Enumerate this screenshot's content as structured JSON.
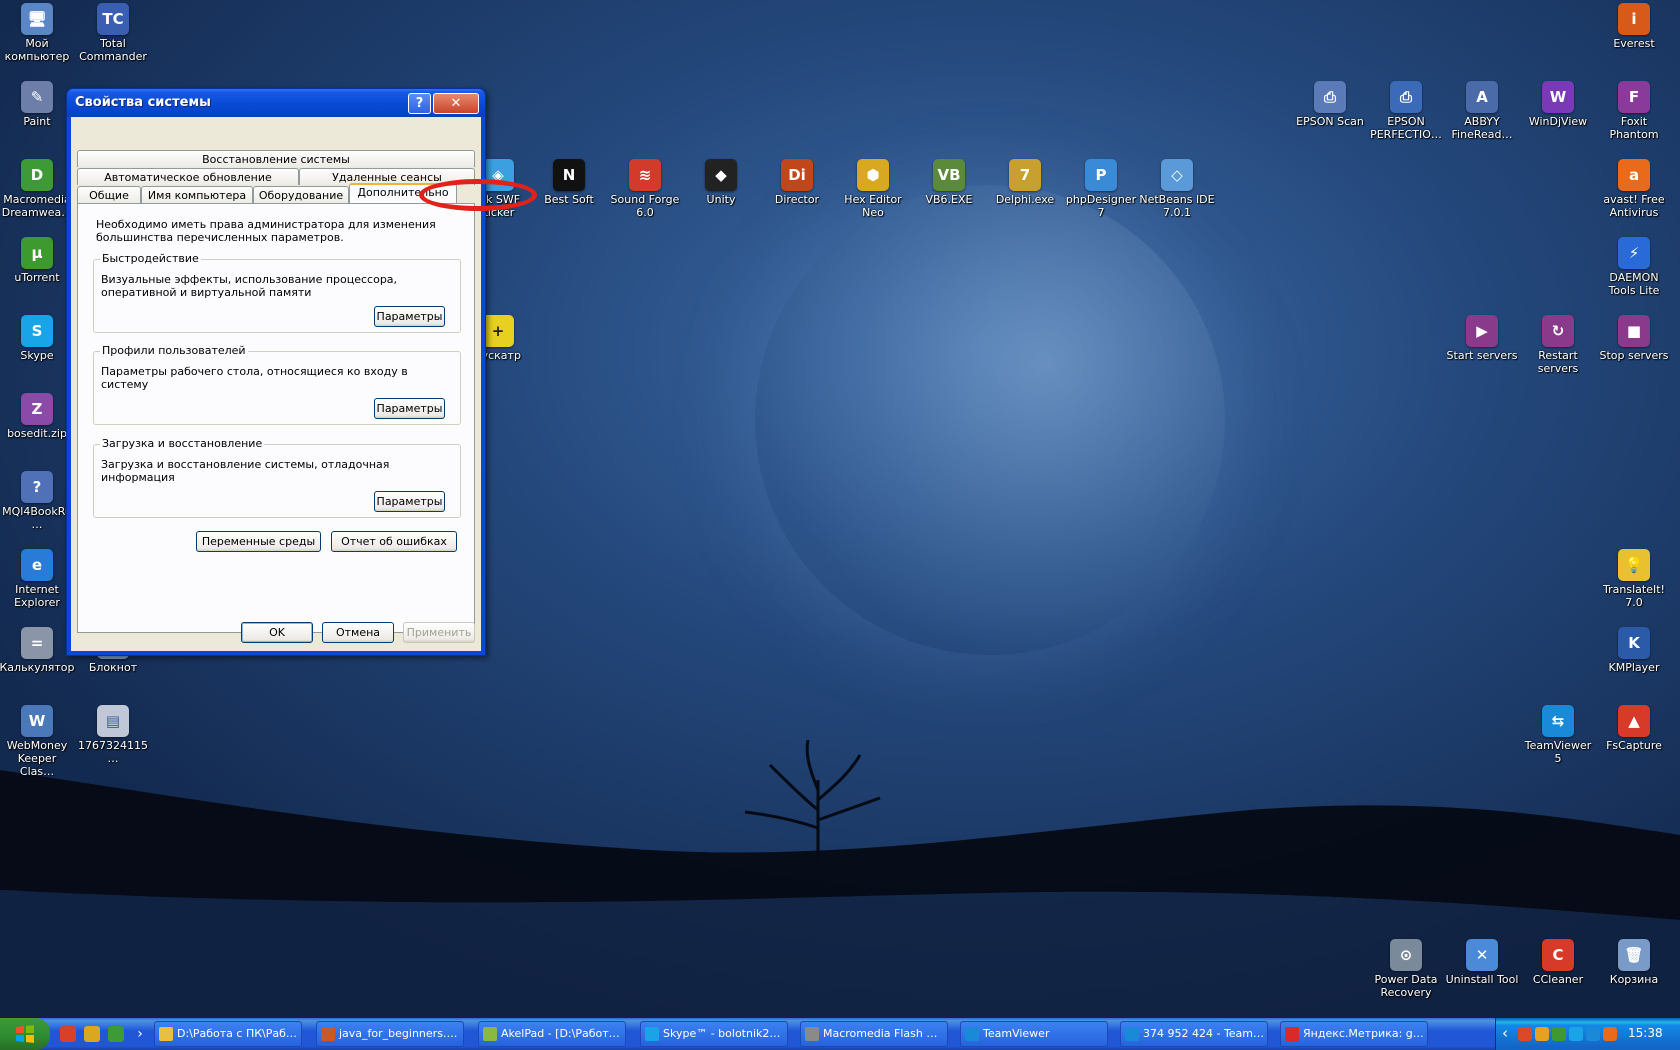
{
  "desktop": {
    "icons": [
      {
        "label": "Мой компьютер",
        "glyph": "🖥",
        "color": "#5a86c6"
      },
      {
        "label": "Total Commander",
        "glyph": "TC",
        "color": "#3b5fb0"
      },
      {
        "label": "Paint",
        "glyph": "✎",
        "color": "#6d7fa8"
      },
      {
        "label": "Macromedia Dreamwea…",
        "glyph": "D",
        "color": "#3d9a36"
      },
      {
        "label": "uTorrent",
        "glyph": "µ",
        "color": "#3e9a2e"
      },
      {
        "label": "Skype",
        "glyph": "S",
        "color": "#1aa4e8"
      },
      {
        "label": "bosedit.zip",
        "glyph": "Z",
        "color": "#8a4aa8"
      },
      {
        "label": "MQl4BookRu…",
        "glyph": "?",
        "color": "#5070b8"
      },
      {
        "label": "Internet Explorer",
        "glyph": "e",
        "color": "#2a7ad8"
      },
      {
        "label": "Калькулятор",
        "glyph": "=",
        "color": "#8a96a8"
      },
      {
        "label": "Блокнот",
        "glyph": "≡",
        "color": "#7aa0d0"
      },
      {
        "label": "WebMoney Keeper Clas…",
        "glyph": "W",
        "color": "#4a78b8"
      },
      {
        "label": "1767324115…",
        "glyph": "▤",
        "color": "#c0c8d8"
      },
      {
        "label": "ink SWF Licker",
        "glyph": "◈",
        "color": "#3aa0e0"
      },
      {
        "label": "Best Soft",
        "glyph": "N",
        "color": "#111111"
      },
      {
        "label": "Sound Forge 6.0",
        "glyph": "≋",
        "color": "#d23b2a"
      },
      {
        "label": "Unity",
        "glyph": "◆",
        "color": "#222222"
      },
      {
        "label": "Director",
        "glyph": "Di",
        "color": "#c1471a"
      },
      {
        "label": "Hex Editor Neo",
        "glyph": "⬢",
        "color": "#d8a820"
      },
      {
        "label": "VB6.EXE",
        "glyph": "VB",
        "color": "#5a8a3a"
      },
      {
        "label": "Delphi.exe",
        "glyph": "7",
        "color": "#c8a030"
      },
      {
        "label": "phpDesigner 7",
        "glyph": "P",
        "color": "#3a8ad8"
      },
      {
        "label": "NetBeans IDE 7.0.1",
        "glyph": "◇",
        "color": "#5a9ad8"
      },
      {
        "label": "уускатр",
        "glyph": "+",
        "color": "#e8d020"
      },
      {
        "label": "Everest",
        "glyph": "i",
        "color": "#d85a1a"
      },
      {
        "label": "EPSON Scan",
        "glyph": "⎙",
        "color": "#5a7ab8"
      },
      {
        "label": "EPSON PERFECTIO…",
        "glyph": "⎙",
        "color": "#3a6ab8"
      },
      {
        "label": "ABBYY FineRead…",
        "glyph": "A",
        "color": "#4a6aa8"
      },
      {
        "label": "WinDjView",
        "glyph": "W",
        "color": "#7a3ab8"
      },
      {
        "label": "Foxit Phantom",
        "glyph": "F",
        "color": "#8a3a9a"
      },
      {
        "label": "avast! Free Antivirus",
        "glyph": "a",
        "color": "#e86a1a"
      },
      {
        "label": "DAEMON Tools Lite",
        "glyph": "⚡",
        "color": "#2a6ad8"
      },
      {
        "label": "Start servers",
        "glyph": "▶",
        "color": "#8a3a8a"
      },
      {
        "label": "Restart servers",
        "glyph": "↻",
        "color": "#8a3a8a"
      },
      {
        "label": "Stop servers",
        "glyph": "■",
        "color": "#8a3a8a"
      },
      {
        "label": "TranslateIt! 7.0",
        "glyph": "💡",
        "color": "#e8c030"
      },
      {
        "label": "KMPlayer",
        "glyph": "K",
        "color": "#2a5aa8"
      },
      {
        "label": "TeamViewer 5",
        "glyph": "⇆",
        "color": "#1a8ad8"
      },
      {
        "label": "FsCapture",
        "glyph": "▲",
        "color": "#d83a2a"
      },
      {
        "label": "Power Data Recovery",
        "glyph": "⊙",
        "color": "#7a8a9a"
      },
      {
        "label": "Uninstall Tool",
        "glyph": "✕",
        "color": "#4a8ad8"
      },
      {
        "label": "CCleaner",
        "glyph": "C",
        "color": "#d83a2a"
      },
      {
        "label": "Корзина",
        "glyph": "🗑",
        "color": "#7a9ac8"
      }
    ]
  },
  "dialog": {
    "title": "Свойства системы",
    "help_glyph": "?",
    "close_glyph": "✕",
    "tabs": {
      "row1": [
        "Восстановление системы"
      ],
      "row2": [
        "Автоматическое обновление",
        "Удаленные сеансы"
      ],
      "row3": [
        "Общие",
        "Имя компьютера",
        "Оборудование",
        "Дополнительно"
      ],
      "active": "Дополнительно"
    },
    "admin_note": "Необходимо иметь права администратора для изменения большинства перечисленных параметров.",
    "groups": [
      {
        "title": "Быстродействие",
        "description": "Визуальные эффекты, использование процессора, оперативной и виртуальной памяти",
        "button": "Параметры"
      },
      {
        "title": "Профили пользователей",
        "description": "Параметры рабочего стола, относящиеся ко входу в систему",
        "button": "Параметры"
      },
      {
        "title": "Загрузка и восстановление",
        "description": "Загрузка и восстановление системы, отладочная информация",
        "button": "Параметры"
      }
    ],
    "env_button": "Переменные среды",
    "error_report_button": "Отчет об ошибках",
    "ok_button": "OK",
    "cancel_button": "Отмена",
    "apply_button": "Применить"
  },
  "taskbar": {
    "quick_launch_more": "›",
    "tasks": [
      {
        "label": "D:\\Работа с ПК\\Раб…",
        "color": "#e8c040"
      },
      {
        "label": "java_for_beginners….",
        "color": "#c85a2a"
      },
      {
        "label": "AkelPad - [D:\\Работ…",
        "color": "#8ab840"
      },
      {
        "label": "Skype™ - bolotnik2…",
        "color": "#1aa4e8"
      },
      {
        "label": "Macromedia Flash …",
        "color": "#8a8a8a"
      },
      {
        "label": "TeamViewer",
        "color": "#1a8ad8"
      },
      {
        "label": "374 952 424 - Team…",
        "color": "#1a8ad8"
      },
      {
        "label": "Яндекс.Метрика: g…",
        "color": "#d82a2a"
      }
    ],
    "tray_expand": "‹",
    "clock": "15:38"
  },
  "colors": {
    "highlight_ring": "#e0221b",
    "title_bar": "#0a4cd6",
    "dialog_face": "#ece9d8"
  }
}
